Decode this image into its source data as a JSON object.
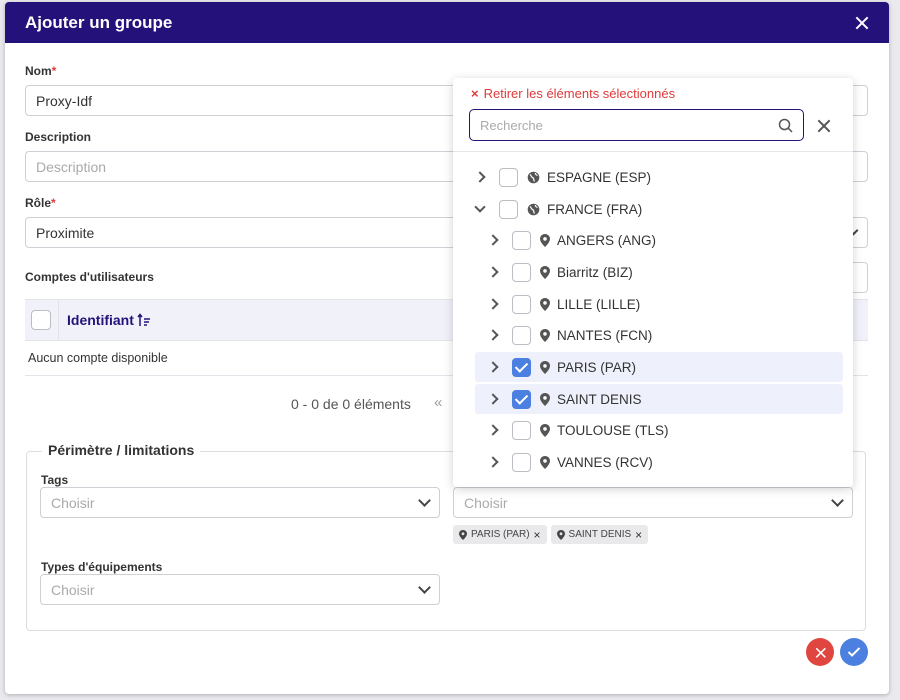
{
  "modal": {
    "title": "Ajouter un groupe"
  },
  "form": {
    "nom_label": "Nom",
    "nom_value": "Proxy-Idf",
    "description_label": "Description",
    "description_placeholder": "Description",
    "role_label": "Rôle",
    "role_value": "Proximite",
    "comptes_label": "Comptes d'utilisateurs",
    "required_mark": "*"
  },
  "table": {
    "column_identifiant": "Identifiant",
    "empty_text": "Aucun compte disponible",
    "pagination_text": "0 - 0 de 0 éléments",
    "first_page_glyph": "«"
  },
  "perimetre": {
    "legend": "Périmètre / limitations",
    "tags_label": "Tags",
    "tags_placeholder": "Choisir",
    "lieux_placeholder": "Choisir",
    "types_label": "Types d'équipements",
    "types_placeholder": "Choisir",
    "chips": [
      {
        "label": "PARIS (PAR)"
      },
      {
        "label": "SAINT DENIS"
      }
    ]
  },
  "dropdown": {
    "clear_label": "Retirer les éléments sélectionnés",
    "search_placeholder": "Recherche",
    "items": [
      {
        "label": "ESPAGNE (ESP)",
        "icon": "globe-icon",
        "checked": false,
        "expanded": false
      },
      {
        "label": "FRANCE (FRA)",
        "icon": "globe-icon",
        "checked": false,
        "expanded": true
      },
      {
        "label": "ANGERS (ANG)",
        "icon": "map-pin-icon",
        "checked": false,
        "expanded": false
      },
      {
        "label": "Biarritz (BIZ)",
        "icon": "map-pin-icon",
        "checked": false,
        "expanded": false
      },
      {
        "label": "LILLE (LILLE)",
        "icon": "map-pin-icon",
        "checked": false,
        "expanded": false
      },
      {
        "label": "NANTES (FCN)",
        "icon": "map-pin-icon",
        "checked": false,
        "expanded": false
      },
      {
        "label": "PARIS (PAR)",
        "icon": "map-pin-icon",
        "checked": true,
        "expanded": false
      },
      {
        "label": "SAINT DENIS",
        "icon": "map-pin-icon",
        "checked": true,
        "expanded": false
      },
      {
        "label": "TOULOUSE (TLS)",
        "icon": "map-pin-icon",
        "checked": false,
        "expanded": false
      },
      {
        "label": "VANNES (RCV)",
        "icon": "map-pin-icon",
        "checked": false,
        "expanded": false
      }
    ]
  },
  "colors": {
    "header_bg": "#24127a",
    "accent_blue": "#4b7fe0",
    "danger_red": "#e03a3a"
  }
}
